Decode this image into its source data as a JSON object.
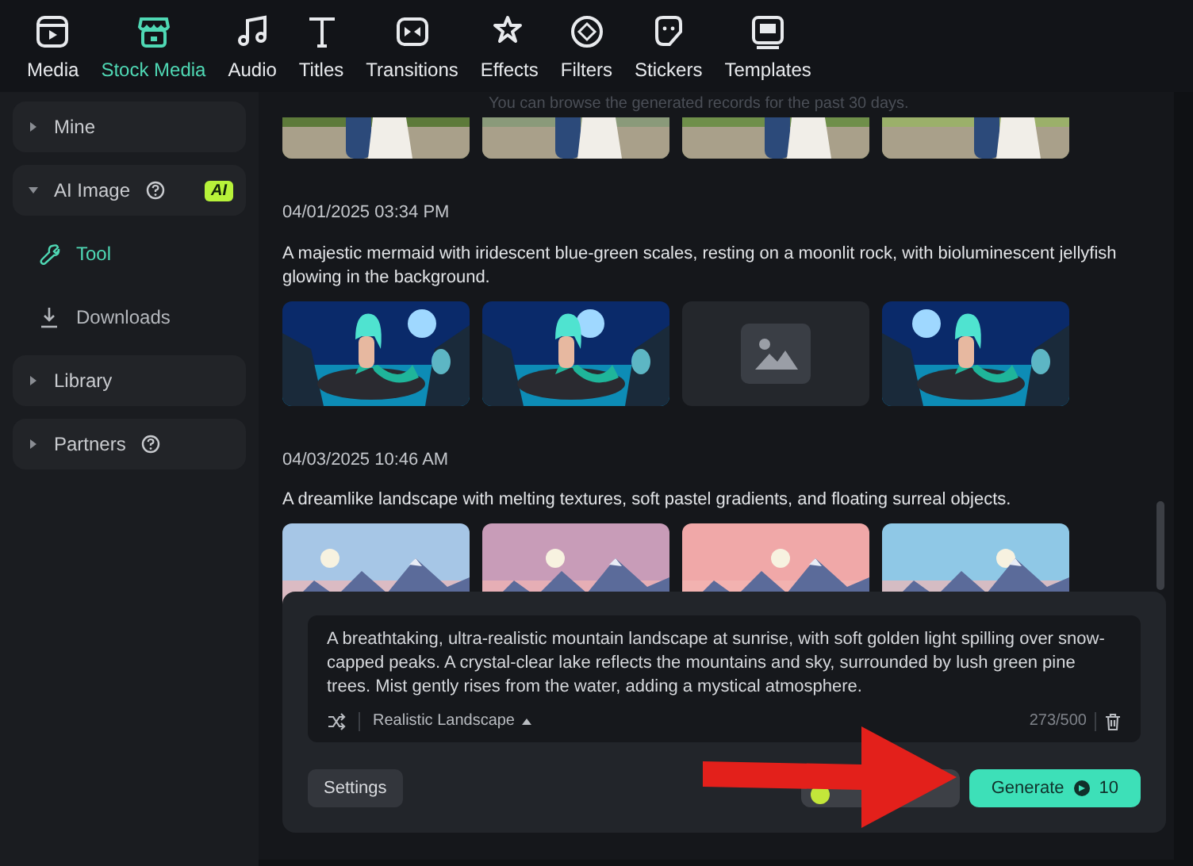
{
  "toolbar": {
    "tabs": [
      {
        "label": "Media",
        "selected": false
      },
      {
        "label": "Stock Media",
        "selected": true
      },
      {
        "label": "Audio",
        "selected": false
      },
      {
        "label": "Titles",
        "selected": false
      },
      {
        "label": "Transitions",
        "selected": false
      },
      {
        "label": "Effects",
        "selected": false
      },
      {
        "label": "Filters",
        "selected": false
      },
      {
        "label": "Stickers",
        "selected": false
      },
      {
        "label": "Templates",
        "selected": false
      }
    ]
  },
  "sidebar": {
    "items": [
      {
        "label": "Mine",
        "expanded": false
      },
      {
        "label": "AI Image",
        "expanded": true,
        "help": true,
        "badge": "AI",
        "children": [
          {
            "label": "Tool",
            "selected": true
          },
          {
            "label": "Downloads",
            "selected": false
          }
        ]
      },
      {
        "label": "Library",
        "expanded": false
      },
      {
        "label": "Partners",
        "expanded": false,
        "help": true
      }
    ]
  },
  "notice": "You can browse the generated records for the past 30 days.",
  "records": [
    {
      "images": [
        {
          "kind": "picture"
        },
        {
          "kind": "picture"
        },
        {
          "kind": "picture"
        },
        {
          "kind": "picture"
        }
      ]
    },
    {
      "timestamp": "04/01/2025 03:34 PM",
      "prompt": "A majestic mermaid with iridescent blue-green scales, resting on a moonlit rock, with bioluminescent jellyfish glowing in the background.",
      "images": [
        {
          "kind": "picture"
        },
        {
          "kind": "picture"
        },
        {
          "kind": "placeholder"
        },
        {
          "kind": "picture"
        }
      ]
    },
    {
      "timestamp": "04/03/2025 10:46 AM",
      "prompt": "A dreamlike landscape with melting textures, soft pastel gradients, and floating surreal objects.",
      "images": [
        {
          "kind": "picture"
        },
        {
          "kind": "picture"
        },
        {
          "kind": "picture"
        },
        {
          "kind": "picture"
        }
      ]
    }
  ],
  "prompt_panel": {
    "prompt_text": "A breathtaking, ultra-realistic mountain landscape at sunrise, with soft golden light spilling over snow-capped peaks. A crystal-clear lake reflects the mountains and sky, surrounded by lush green pine trees. Mist gently rises from the water, adding a mystical atmosphere.",
    "style": "Realistic Landscape",
    "counter": "273/500",
    "settings_button": "Settings",
    "generate_button": {
      "label": "Generate",
      "credits": "10"
    }
  }
}
